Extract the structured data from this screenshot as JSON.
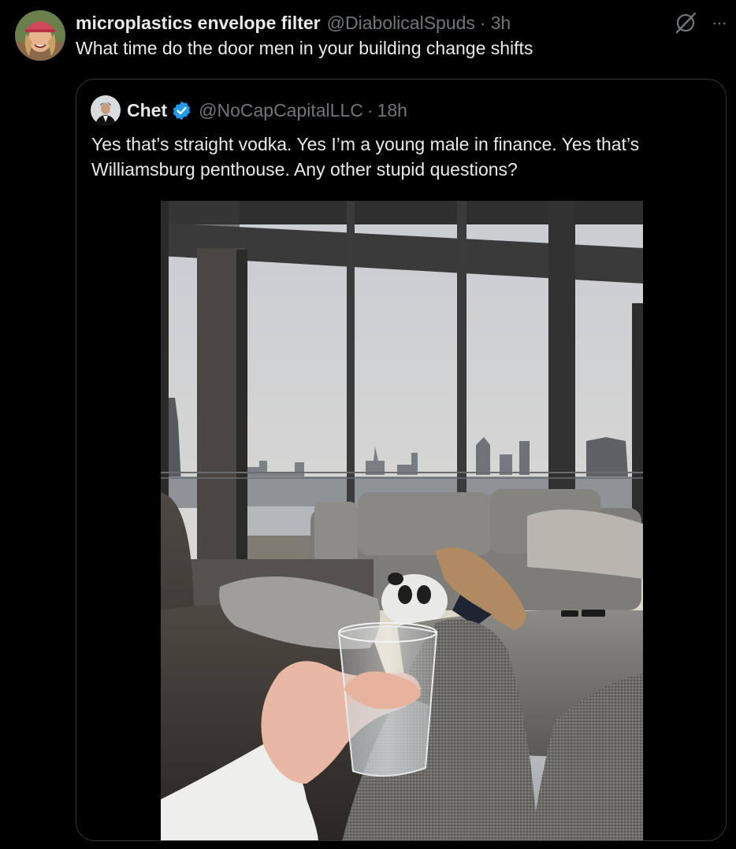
{
  "tweet": {
    "display_name": "microplastics envelope filter",
    "handle": "@DiabolicalSpuds",
    "separator": "·",
    "time": "3h",
    "text": "What time do the door men in your building change shifts",
    "more_label": "···"
  },
  "quoted_tweet": {
    "display_name": "Chet",
    "handle": "@NoCapCapitalLLC",
    "separator": "·",
    "time": "18h",
    "text_lines": [
      "Yes that’s straight vodka. Yes I’m a young male in finance. Yes that’s",
      "Williamsburg penthouse. Any other stupid questions?"
    ]
  },
  "icons": {
    "grok": "grok-icon",
    "more": "more-icon",
    "verified": "verified-badge-icon"
  },
  "colors": {
    "background": "#000000",
    "text_primary": "#e7e9ea",
    "text_secondary": "#71767b",
    "border": "#2f3336",
    "verified_blue": "#1d9bf0"
  }
}
